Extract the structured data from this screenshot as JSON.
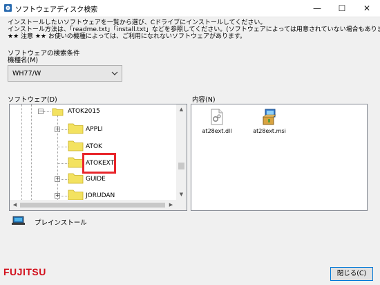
{
  "window": {
    "title": "ソフトウェアディスク検索",
    "minimize": "—",
    "maximize": "☐",
    "close": "✕"
  },
  "intro": {
    "line1": "インストールしたいソフトウェアを一覧から選び、Cドライブにインストールしてください。",
    "line2": "インストール方法は、「readme.txt」「install.txt」などを参照してください。(ソフトウェアによっては用意されていない場合もあります)",
    "line3": "★★ 注意 ★★ お使いの機種によっては、ご利用になれないソフトウェアがあります。"
  },
  "conditions": {
    "title": "ソフトウェアの検索条件",
    "model_label": "機種名(M)",
    "model_value": "WH77/W"
  },
  "software": {
    "label": "ソフトウェア(D)",
    "tree": [
      {
        "label": "ATOK2015",
        "expander": "−"
      },
      {
        "label": "APPLI",
        "expander": "+"
      },
      {
        "label": "ATOK",
        "expander": ""
      },
      {
        "label": "ATOKEXT",
        "expander": ""
      },
      {
        "label": "GUIDE",
        "expander": "+"
      },
      {
        "label": "JORUDAN",
        "expander": "+"
      }
    ],
    "scroll": {
      "up": "▲",
      "down": "▼",
      "left": "◀",
      "right": "▶"
    }
  },
  "contents": {
    "label": "内容(N)",
    "files": [
      {
        "name": "at28ext.dll",
        "icon": "dll-file-icon"
      },
      {
        "name": "at28ext.msi",
        "icon": "installer-package-icon"
      }
    ]
  },
  "install": {
    "label": "プレインストール",
    "icon": "laptop-install-icon"
  },
  "footer": {
    "logo": "FUJITSU",
    "close_label": "閉じる(C)"
  },
  "colors": {
    "highlight": "#e8262b",
    "logo": "#d2101c",
    "folder": "#f3e260",
    "button_border": "#0078d7"
  }
}
